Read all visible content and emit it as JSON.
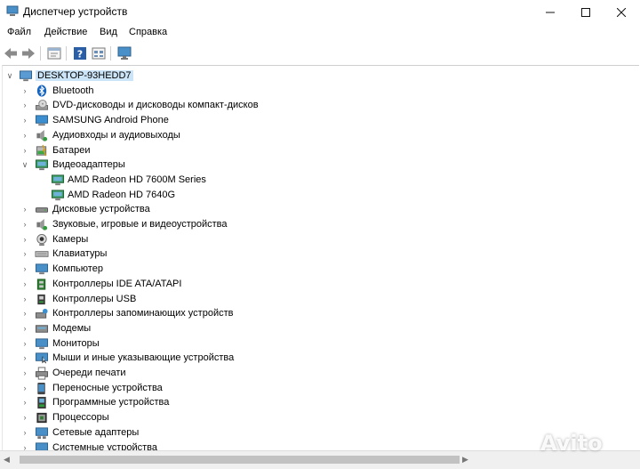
{
  "window": {
    "title": "Диспетчер устройств"
  },
  "menu": [
    {
      "label": "Файл"
    },
    {
      "label": "Действие"
    },
    {
      "label": "Вид"
    },
    {
      "label": "Справка"
    }
  ],
  "tree": {
    "root": {
      "label": "DESKTOP-93HEDD7",
      "icon": "computer-icon",
      "expanded": true
    },
    "items": [
      {
        "label": "Bluetooth",
        "icon": "bluetooth-icon",
        "level": 1,
        "expander": "collapsed"
      },
      {
        "label": "DVD-дисководы и дисководы компакт-дисков",
        "icon": "dvd-drive-icon",
        "level": 1,
        "expander": "collapsed"
      },
      {
        "label": "SAMSUNG Android Phone",
        "icon": "phone-monitor-icon",
        "level": 1,
        "expander": "collapsed"
      },
      {
        "label": "Аудиовходы и аудиовыходы",
        "icon": "speaker-icon",
        "level": 1,
        "expander": "collapsed"
      },
      {
        "label": "Батареи",
        "icon": "battery-icon",
        "level": 1,
        "expander": "collapsed"
      },
      {
        "label": "Видеоадаптеры",
        "icon": "display-adapter-icon",
        "level": 1,
        "expander": "expanded"
      },
      {
        "label": "AMD Radeon HD 7600M Series",
        "icon": "display-adapter-icon",
        "level": 2,
        "expander": "none"
      },
      {
        "label": "AMD Radeon HD 7640G",
        "icon": "display-adapter-icon",
        "level": 2,
        "expander": "none"
      },
      {
        "label": "Дисковые устройства",
        "icon": "disk-drive-icon",
        "level": 1,
        "expander": "collapsed"
      },
      {
        "label": "Звуковые, игровые и видеоустройства",
        "icon": "speaker-icon",
        "level": 1,
        "expander": "collapsed"
      },
      {
        "label": "Камеры",
        "icon": "camera-icon",
        "level": 1,
        "expander": "collapsed"
      },
      {
        "label": "Клавиатуры",
        "icon": "keyboard-icon",
        "level": 1,
        "expander": "collapsed"
      },
      {
        "label": "Компьютер",
        "icon": "monitor-icon",
        "level": 1,
        "expander": "collapsed"
      },
      {
        "label": "Контроллеры IDE ATA/ATAPI",
        "icon": "ide-controller-icon",
        "level": 1,
        "expander": "collapsed"
      },
      {
        "label": "Контроллеры USB",
        "icon": "usb-icon",
        "level": 1,
        "expander": "collapsed"
      },
      {
        "label": "Контроллеры запоминающих устройств",
        "icon": "storage-controller-icon",
        "level": 1,
        "expander": "collapsed"
      },
      {
        "label": "Модемы",
        "icon": "modem-icon",
        "level": 1,
        "expander": "collapsed"
      },
      {
        "label": "Мониторы",
        "icon": "monitor-icon",
        "level": 1,
        "expander": "collapsed"
      },
      {
        "label": "Мыши и иные указывающие устройства",
        "icon": "mouse-icon",
        "level": 1,
        "expander": "collapsed"
      },
      {
        "label": "Очереди печати",
        "icon": "printer-icon",
        "level": 1,
        "expander": "collapsed"
      },
      {
        "label": "Переносные устройства",
        "icon": "portable-device-icon",
        "level": 1,
        "expander": "collapsed"
      },
      {
        "label": "Программные устройства",
        "icon": "software-device-icon",
        "level": 1,
        "expander": "collapsed"
      },
      {
        "label": "Процессоры",
        "icon": "processor-icon",
        "level": 1,
        "expander": "collapsed"
      },
      {
        "label": "Сетевые адаптеры",
        "icon": "network-adapter-icon",
        "level": 1,
        "expander": "collapsed"
      },
      {
        "label": "Системные устройства",
        "icon": "system-device-icon",
        "level": 1,
        "expander": "collapsed"
      }
    ]
  },
  "watermark": {
    "text": "Avito"
  }
}
